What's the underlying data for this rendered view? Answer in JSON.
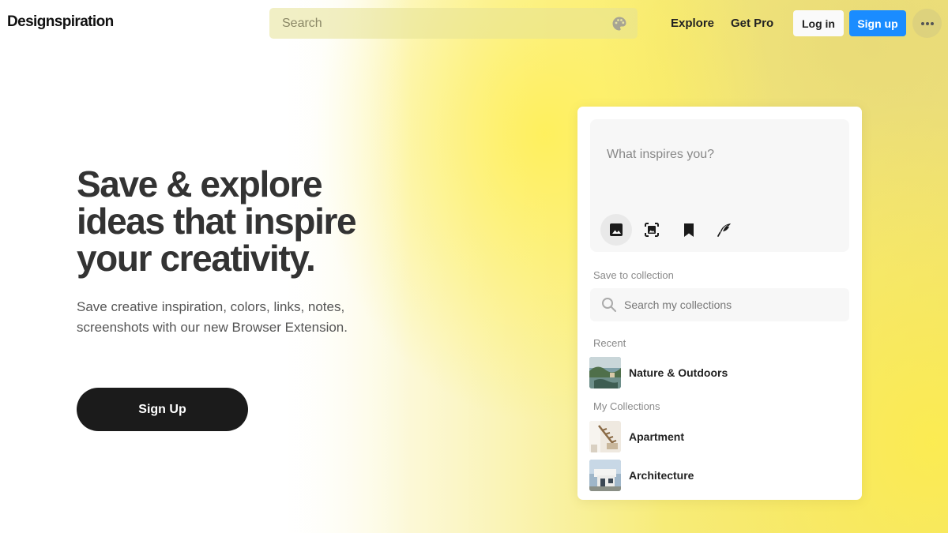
{
  "header": {
    "logo": "Designspiration",
    "search_placeholder": "Search",
    "nav": {
      "explore": "Explore",
      "get_pro": "Get Pro"
    },
    "login_label": "Log in",
    "signup_label": "Sign up",
    "more_icon": "more-horizontal-icon",
    "palette_icon": "palette-icon"
  },
  "hero": {
    "title": "Save & explore ideas that inspire your creativity.",
    "subtitle": "Save creative inspiration, colors, links, notes, screenshots with our new Browser Extension.",
    "cta": "Sign Up"
  },
  "card": {
    "composer_placeholder": "What inspires you?",
    "tools": [
      {
        "icon": "image-icon",
        "active": true
      },
      {
        "icon": "screenshot-icon",
        "active": false
      },
      {
        "icon": "bookmark-icon",
        "active": false
      },
      {
        "icon": "quill-icon",
        "active": false
      }
    ],
    "save_label": "Save to collection",
    "search_placeholder": "Search my collections",
    "recent_label": "Recent",
    "recent": [
      {
        "name": "Nature & Outdoors"
      }
    ],
    "my_collections_label": "My Collections",
    "collections": [
      {
        "name": "Apartment"
      },
      {
        "name": "Architecture"
      }
    ]
  },
  "colors": {
    "accent_blue": "#1a8cff",
    "cta_dark": "#1b1b1b",
    "background_yellow": "#f7ec7a"
  }
}
